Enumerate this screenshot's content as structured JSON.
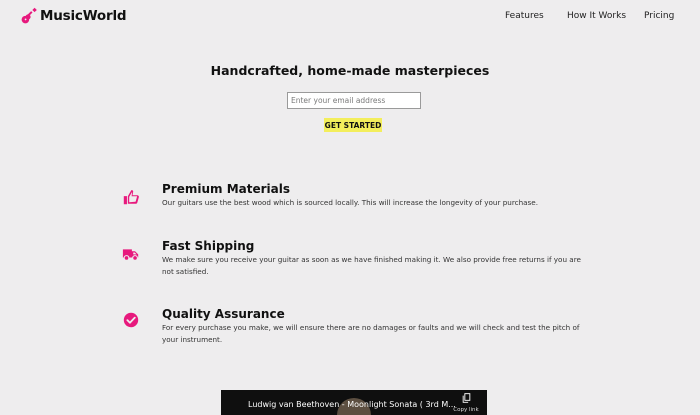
{
  "header": {
    "brand": "MusicWorld",
    "brand_icon": "guitar-icon",
    "nav": [
      "Features",
      "How It Works",
      "Pricing"
    ]
  },
  "hero": {
    "title": "Handcrafted, home-made masterpieces",
    "email_placeholder": "Enter your email address",
    "cta_label": "GET STARTED"
  },
  "features": [
    {
      "icon": "thumbs-up-icon",
      "title": "Premium Materials",
      "description": "Our guitars use the best wood which is sourced locally. This will increase the longevity of your purchase."
    },
    {
      "icon": "truck-icon",
      "title": "Fast Shipping",
      "description": "We make sure you receive your guitar as soon as we have finished making it. We also provide free returns if you are not satisfied."
    },
    {
      "icon": "check-circle-icon",
      "title": "Quality Assurance",
      "description": "For every purchase you make, we will ensure there are no damages or faults and we will check and test the pitch of your instrument."
    }
  ],
  "video": {
    "title": "Ludwig van Beethoven - Moonlight Sonata ( 3rd M...",
    "copy_label": "Copy link"
  },
  "colors": {
    "background": "#eeedee",
    "accent": "#e7197d",
    "cta": "#f3ee5c"
  }
}
